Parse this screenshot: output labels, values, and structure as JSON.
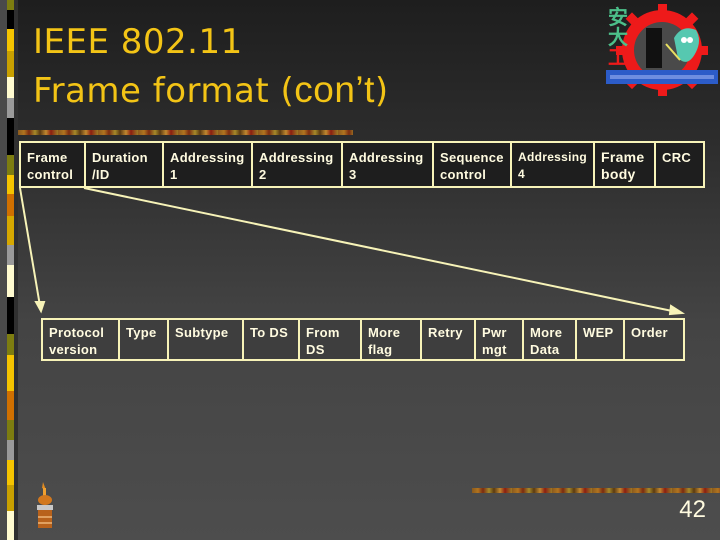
{
  "slide": {
    "title_line1": "IEEE 802.11",
    "title_line2_main": "Frame format (",
    "title_line2_cont": "con’t",
    "title_line2_close": ")",
    "page_number": "42"
  },
  "colors": {
    "title": "#f3c416",
    "table_border": "#f7f3b8",
    "table_text": "#fffbe0"
  },
  "frame_fields": [
    {
      "label": "Frame\ncontrol"
    },
    {
      "label": "Duration\n/ID"
    },
    {
      "label": "Addressing\n1"
    },
    {
      "label": "Addressing\n2"
    },
    {
      "label": "Addressing\n3"
    },
    {
      "label": "Sequence\ncontrol"
    },
    {
      "label": "Addressing\n4"
    },
    {
      "label": "Frame\nbody"
    },
    {
      "label": "CRC"
    }
  ],
  "frame_control_fields": [
    {
      "label": "Protocol\nversion"
    },
    {
      "label": "Type"
    },
    {
      "label": "Subtype"
    },
    {
      "label": "To DS"
    },
    {
      "label": "From\nDS"
    },
    {
      "label": "More\nflag"
    },
    {
      "label": "Retry"
    },
    {
      "label": "Pwr\nmgt"
    },
    {
      "label": "More\nData"
    },
    {
      "label": "WEP"
    },
    {
      "label": "Order"
    }
  ],
  "icons": {
    "logo": "university-gear-logo",
    "decoration": "candle-icon"
  }
}
